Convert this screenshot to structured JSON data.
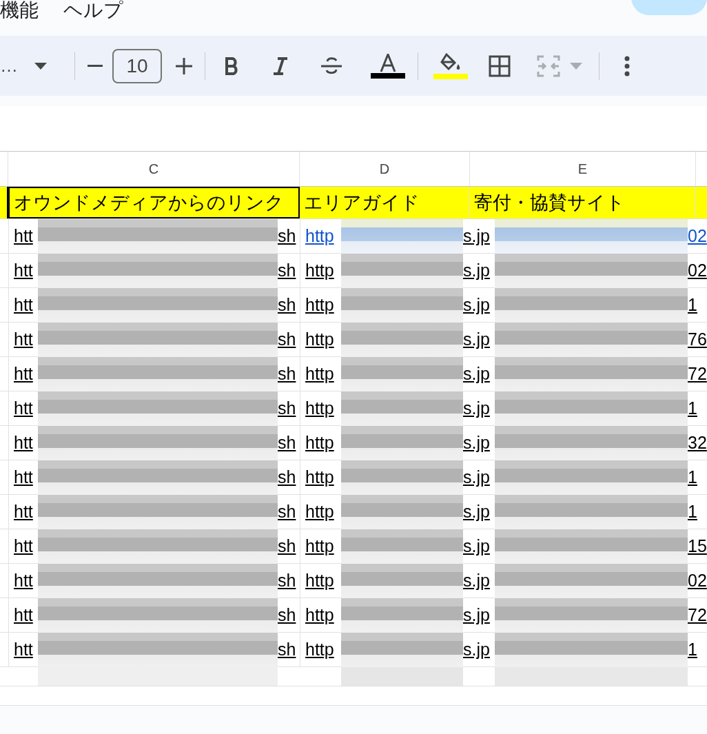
{
  "menu": [
    "機能",
    "ヘルプ"
  ],
  "toolbar": {
    "font_name": "…",
    "font_size": "10",
    "merge_disabled": true
  },
  "column_headers": [
    "C",
    "D",
    "E"
  ],
  "header_row": [
    {
      "text": "オウンドメディアからのリンク",
      "selected": true
    },
    {
      "text": "エリアガイド",
      "selected": false
    },
    {
      "text": "寄付・協賛サイト",
      "selected": false
    }
  ],
  "rows": [
    {
      "highlighted": true,
      "c_start": "htt",
      "c_end": "sh",
      "d_start": "http",
      "d_end": "s.jp",
      "e_end": "02"
    },
    {
      "highlighted": false,
      "c_start": "htt",
      "c_end": "sh",
      "d_start": "http",
      "d_end": "s.jp",
      "e_end": "02"
    },
    {
      "highlighted": false,
      "c_start": "htt",
      "c_end": "sh",
      "d_start": "http",
      "d_end": "s.jp",
      "e_end": "1"
    },
    {
      "highlighted": false,
      "c_start": "htt",
      "c_end": "sh",
      "d_start": "http",
      "d_end": "s.jp",
      "e_end": "76"
    },
    {
      "highlighted": false,
      "c_start": "htt",
      "c_end": "sh",
      "d_start": "http",
      "d_end": "s.jp",
      "e_end": "72"
    },
    {
      "highlighted": false,
      "c_start": "htt",
      "c_end": "sh",
      "d_start": "http",
      "d_end": "s.jp",
      "e_end": "1"
    },
    {
      "highlighted": false,
      "c_start": "htt",
      "c_end": "sh",
      "d_start": "http",
      "d_end": "s.jp",
      "e_end": "32"
    },
    {
      "highlighted": false,
      "c_start": "htt",
      "c_end": "sh",
      "d_start": "http",
      "d_end": "s.jp",
      "e_end": "1"
    },
    {
      "highlighted": false,
      "c_start": "htt",
      "c_end": "sh",
      "d_start": "http",
      "d_end": "s.jp",
      "e_end": "1"
    },
    {
      "highlighted": false,
      "c_start": "htt",
      "c_end": "sh",
      "d_start": "http",
      "d_end": "s.jp",
      "e_end": "15"
    },
    {
      "highlighted": false,
      "c_start": "htt",
      "c_end": "sh",
      "d_start": "http",
      "d_end": "s.jp",
      "e_end": "02"
    },
    {
      "highlighted": false,
      "c_start": "htt",
      "c_end": "sh",
      "d_start": "http",
      "d_end": "s.jp",
      "e_end": "72"
    },
    {
      "highlighted": false,
      "c_start": "htt",
      "c_end": "sh",
      "d_start": "http",
      "d_end": "s.jp",
      "e_end": "1"
    }
  ]
}
